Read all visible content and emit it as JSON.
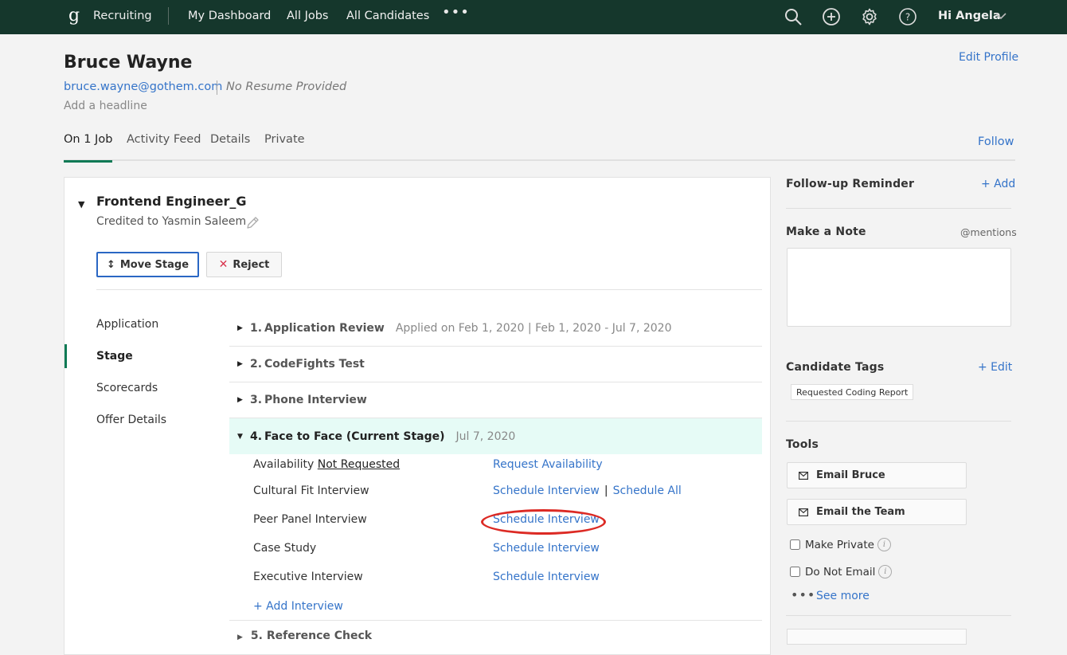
{
  "topnav": {
    "logo_glyph": "g",
    "app_name": "Recruiting",
    "items": [
      {
        "label": "My Dashboard"
      },
      {
        "label": "All Jobs"
      },
      {
        "label": "All Candidates"
      }
    ],
    "more_glyph": "•••",
    "icons": [
      "search-icon",
      "add-circle-icon",
      "gear-icon",
      "help-icon"
    ],
    "greeting": "Hi Angela"
  },
  "candidate": {
    "name": "Bruce Wayne",
    "email": "bruce.wayne@gothem.com",
    "resume_status": "No Resume Provided",
    "headline_placeholder": "Add a headline",
    "edit_profile": "Edit Profile"
  },
  "tabs": [
    {
      "label": "On 1 Job",
      "active": true
    },
    {
      "label": "Activity Feed",
      "active": false
    },
    {
      "label": "Details",
      "active": false
    },
    {
      "label": "Private",
      "active": false
    }
  ],
  "follow_label": "Follow",
  "job": {
    "caret": "▼",
    "title": "Frontend Engineer_G",
    "credited": "Credited to Yasmin Saleem",
    "move_stage": "Move Stage",
    "reject": "Reject",
    "reject_glyph": "✕",
    "move_glyph": "↕"
  },
  "subnav": [
    {
      "label": "Application",
      "active": false
    },
    {
      "label": "Stage",
      "active": true
    },
    {
      "label": "Scorecards",
      "active": false
    },
    {
      "label": "Offer Details",
      "active": false
    }
  ],
  "stages": [
    {
      "num": "1.",
      "title": "Application Review",
      "meta": "Applied on Feb 1, 2020 | Feb 1, 2020 - Jul 7, 2020",
      "expanded": false,
      "caret": "▶"
    },
    {
      "num": "2.",
      "title": "CodeFights Test",
      "meta": "",
      "expanded": false,
      "caret": "▶"
    },
    {
      "num": "3.",
      "title": "Phone Interview",
      "meta": "",
      "expanded": false,
      "caret": "▶"
    },
    {
      "num": "4.",
      "title": "Face to Face (Current Stage)",
      "meta": "Jul 7, 2020",
      "expanded": true,
      "caret": "▼"
    }
  ],
  "availability": {
    "label": "Availability",
    "status": "Not Requested",
    "action": "Request Availability"
  },
  "interviews": [
    {
      "name": "Cultural Fit Interview",
      "action": "Schedule Interview",
      "extra": "Schedule All"
    },
    {
      "name": "Peer Panel Interview",
      "action": "Schedule Interview",
      "highlighted": true
    },
    {
      "name": "Case Study",
      "action": "Schedule Interview"
    },
    {
      "name": "Executive Interview",
      "action": "Schedule Interview"
    }
  ],
  "add_interview": "+ Add Interview",
  "next_stage": {
    "caret": "▶",
    "label": "5.  Reference Check"
  },
  "sidebar": {
    "followup_title": "Follow-up Reminder",
    "followup_add": "+ Add",
    "note_title": "Make a Note",
    "note_mentions": "@mentions",
    "note_value": "",
    "tags_title": "Candidate Tags",
    "tags_edit": "+ Edit",
    "tags": [
      "Requested Coding Report"
    ],
    "tools_title": "Tools",
    "tools": [
      {
        "label": "Email Bruce",
        "icon": "envelope-icon"
      },
      {
        "label": "Email the Team",
        "icon": "envelope-icon"
      }
    ],
    "checkboxes": [
      {
        "label": "Make Private",
        "checked": false
      },
      {
        "label": "Do Not Email",
        "checked": false
      }
    ],
    "info_glyph": "i",
    "see_more_dots": "•••",
    "see_more": "See more"
  }
}
